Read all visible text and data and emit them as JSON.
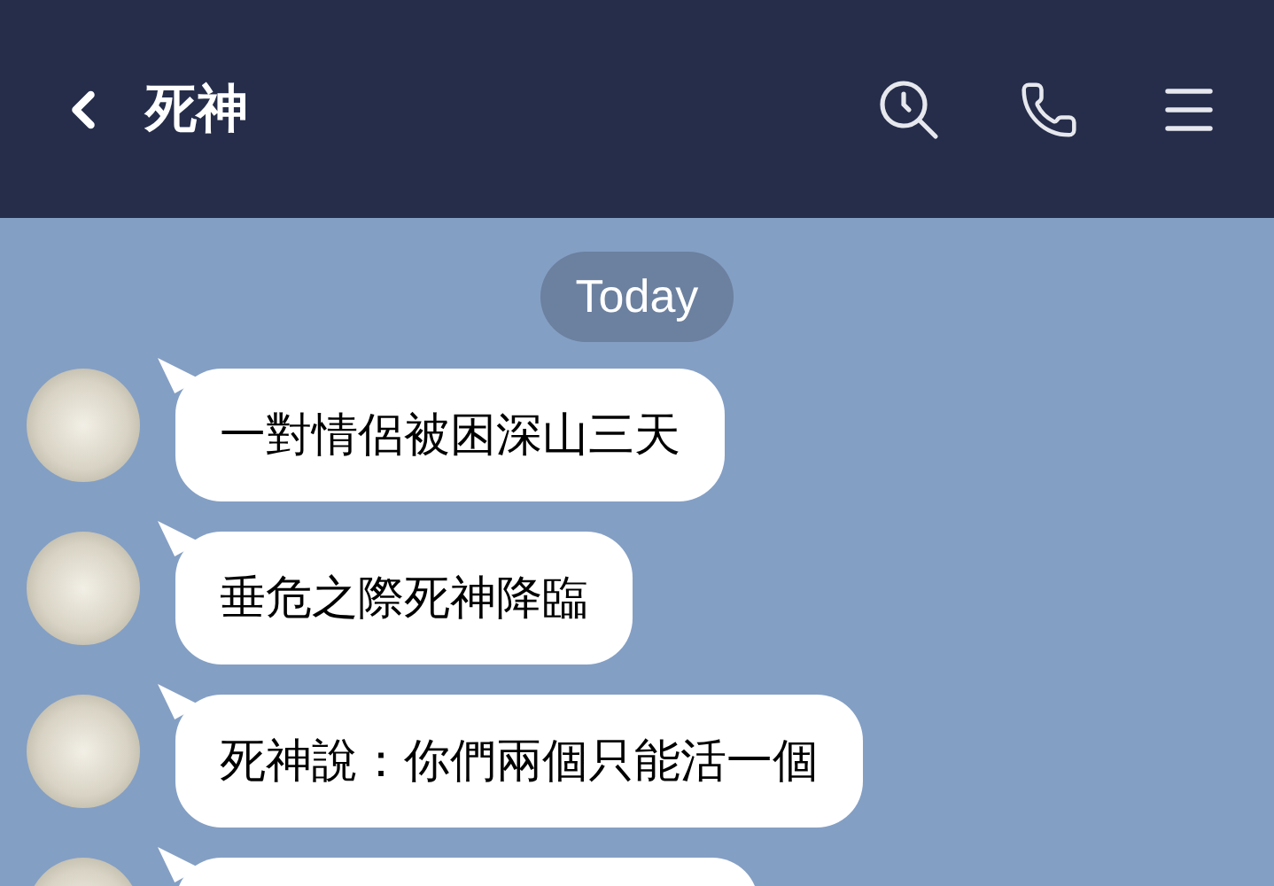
{
  "header": {
    "title": "死神"
  },
  "date_label": "Today",
  "messages": [
    {
      "kind": "text",
      "text": "一對情侶被困深山三天"
    },
    {
      "kind": "text",
      "text": "垂危之際死神降臨"
    },
    {
      "kind": "text",
      "text": "死神說：你們兩個只能活一個"
    },
    {
      "kind": "cut"
    }
  ]
}
